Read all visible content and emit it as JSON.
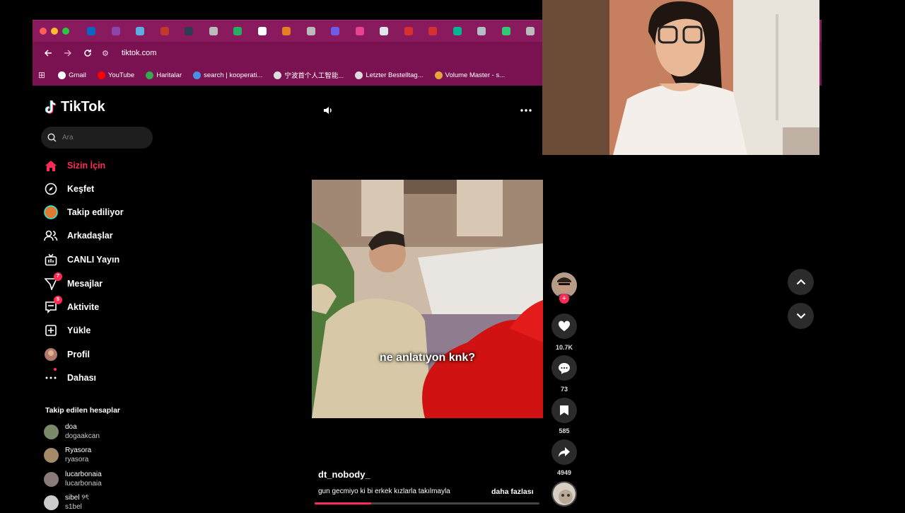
{
  "browser": {
    "url": "tiktok.com",
    "bookmarks": [
      {
        "label": "Gmail",
        "icon": "google-icon",
        "color": "#ffffff"
      },
      {
        "label": "YouTube",
        "icon": "youtube-icon",
        "color": "#ff0000"
      },
      {
        "label": "Haritalar",
        "icon": "maps-icon",
        "color": "#34a853"
      },
      {
        "label": "search | kooperati...",
        "icon": "search-icon",
        "color": "#4a90e2"
      },
      {
        "label": "宁波首个人工智能...",
        "icon": "globe-icon",
        "color": "#dddddd"
      },
      {
        "label": "Letzter Bestelltag...",
        "icon": "globe-icon",
        "color": "#dddddd"
      },
      {
        "label": "Volume Master - s...",
        "icon": "volume-icon",
        "color": "#e8a33a"
      }
    ],
    "tab_colors": [
      "#0a66c2",
      "#8e44ad",
      "#5dade2",
      "#c0392b",
      "#2c3e50",
      "#bbbbbb",
      "#27ae60",
      "#ffffff",
      "#e67e22",
      "#bbbbbb",
      "#6c5ce7",
      "#e84393",
      "#dfe6e9",
      "#d63031",
      "#d63031",
      "#00b894",
      "#b2bec3",
      "#2ecc71",
      "#bbbbbb"
    ]
  },
  "sidebar": {
    "logo": "TikTok",
    "search_placeholder": "Ara",
    "nav": [
      {
        "label": "Sizin İçin",
        "icon": "home-icon",
        "active": true
      },
      {
        "label": "Keşfet",
        "icon": "compass-icon"
      },
      {
        "label": "Takip ediliyor",
        "icon": "following-avatar-icon"
      },
      {
        "label": "Arkadaşlar",
        "icon": "friends-icon"
      },
      {
        "label": "CANLI Yayın",
        "icon": "live-icon"
      },
      {
        "label": "Mesajlar",
        "icon": "messages-icon",
        "badge": "7"
      },
      {
        "label": "Aktivite",
        "icon": "activity-icon",
        "badge": "5"
      },
      {
        "label": "Yükle",
        "icon": "upload-icon"
      },
      {
        "label": "Profil",
        "icon": "profile-avatar-icon"
      },
      {
        "label": "Dahası",
        "icon": "more-icon"
      }
    ],
    "following_title": "Takip edilen hesaplar",
    "accounts": [
      {
        "name": "doa",
        "user": "dogaakcan",
        "color": "#7a8a6a"
      },
      {
        "name": "Ryasora",
        "user": "ryasora",
        "color": "#a58a6a"
      },
      {
        "name": "lucarbonaia",
        "user": "lucarbonaia",
        "color": "#8a7a7a"
      },
      {
        "name": "sibel ୨ৎ",
        "user": "s1bel",
        "color": "#cccccc"
      }
    ]
  },
  "player": {
    "caption": "ne anlatıyon knk?",
    "username": "dt_nobody_",
    "description": "gun gecmiyo ki bi erkek kızlarla takılmayla",
    "more_label": "daha fazlası",
    "progress": 0.25
  },
  "actions": {
    "likes": "10.7K",
    "comments": "73",
    "saves": "585",
    "shares": "4949"
  },
  "colors": {
    "accent": "#fe2c55",
    "chrome": "#8a1a5e"
  }
}
